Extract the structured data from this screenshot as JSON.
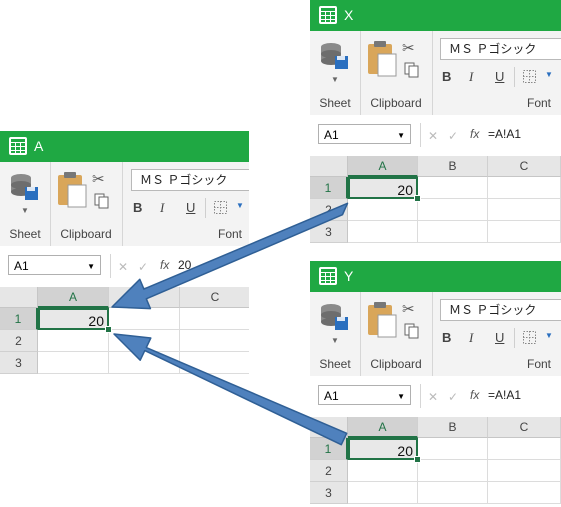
{
  "windows": {
    "a": {
      "title": "A",
      "ribbon": {
        "sheet_label": "Sheet",
        "clipboard_label": "Clipboard",
        "font_label": "Font",
        "font_name": "ＭＳ Ｐゴシック",
        "bold": "B",
        "italic": "I",
        "underline": "U"
      },
      "formula_bar": {
        "name_box": "A1",
        "fx": "fx",
        "content": "20"
      },
      "columns": [
        "A",
        "B",
        "C"
      ],
      "rows": [
        "1",
        "2",
        "3"
      ],
      "a1_value": "20"
    },
    "x": {
      "title": "X",
      "ribbon": {
        "sheet_label": "Sheet",
        "clipboard_label": "Clipboard",
        "font_label": "Font",
        "font_name": "ＭＳ Ｐゴシック",
        "bold": "B",
        "italic": "I",
        "underline": "U"
      },
      "formula_bar": {
        "name_box": "A1",
        "fx": "fx",
        "content": "=A!A1"
      },
      "columns": [
        "A",
        "B",
        "C"
      ],
      "rows": [
        "1",
        "2",
        "3"
      ],
      "a1_value": "20"
    },
    "y": {
      "title": "Y",
      "ribbon": {
        "sheet_label": "Sheet",
        "clipboard_label": "Clipboard",
        "font_label": "Font",
        "font_name": "ＭＳ Ｐゴシック",
        "bold": "B",
        "italic": "I",
        "underline": "U"
      },
      "formula_bar": {
        "name_box": "A1",
        "fx": "fx",
        "content": "=A!A1"
      },
      "columns": [
        "A",
        "B",
        "C"
      ],
      "rows": [
        "1",
        "2",
        "3"
      ],
      "a1_value": "20"
    }
  },
  "colors": {
    "title_bar": "#1fa843",
    "accent": "#217346",
    "arrow": "#4f81bd"
  }
}
